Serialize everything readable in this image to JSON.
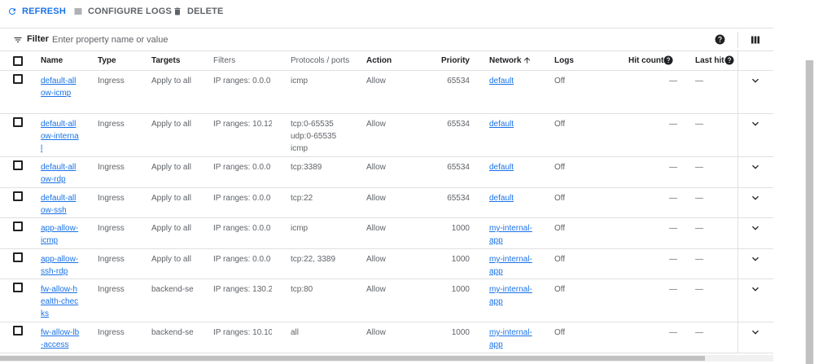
{
  "toolbar": {
    "refresh_label": "REFRESH",
    "configure_logs_label": "CONFIGURE LOGS",
    "delete_label": "DELETE"
  },
  "filter": {
    "label": "Filter",
    "placeholder": "Enter property name or value"
  },
  "table": {
    "headers": {
      "name": "Name",
      "type": "Type",
      "targets": "Targets",
      "filters": "Filters",
      "protocols": "Protocols / ports",
      "action": "Action",
      "priority": "Priority",
      "network": "Network",
      "logs": "Logs",
      "hit_count": "Hit count",
      "last_hit": "Last hit"
    },
    "rows": [
      {
        "name": "default-allow-icmp",
        "type": "Ingress",
        "targets": "Apply to all",
        "filters": "IP ranges: 0.0.0",
        "protocols": "icmp",
        "action": "Allow",
        "priority": "65534",
        "network": "default",
        "logs": "Off",
        "hit_count": "—",
        "last_hit": "—"
      },
      {
        "name": "default-allow-internal",
        "type": "Ingress",
        "targets": "Apply to all",
        "filters": "IP ranges: 10.12",
        "protocols": "tcp:0-65535\nudp:0-65535\nicmp",
        "action": "Allow",
        "priority": "65534",
        "network": "default",
        "logs": "Off",
        "hit_count": "—",
        "last_hit": "—"
      },
      {
        "name": "default-allow-rdp",
        "type": "Ingress",
        "targets": "Apply to all",
        "filters": "IP ranges: 0.0.0",
        "protocols": "tcp:3389",
        "action": "Allow",
        "priority": "65534",
        "network": "default",
        "logs": "Off",
        "hit_count": "—",
        "last_hit": "—"
      },
      {
        "name": "default-allow-ssh",
        "type": "Ingress",
        "targets": "Apply to all",
        "filters": "IP ranges: 0.0.0",
        "protocols": "tcp:22",
        "action": "Allow",
        "priority": "65534",
        "network": "default",
        "logs": "Off",
        "hit_count": "—",
        "last_hit": "—"
      },
      {
        "name": "app-allow-icmp",
        "type": "Ingress",
        "targets": "Apply to all",
        "filters": "IP ranges: 0.0.0",
        "protocols": "icmp",
        "action": "Allow",
        "priority": "1000",
        "network": "my-internal-app",
        "logs": "Off",
        "hit_count": "—",
        "last_hit": "—"
      },
      {
        "name": "app-allow-ssh-rdp",
        "type": "Ingress",
        "targets": "Apply to all",
        "filters": "IP ranges: 0.0.0",
        "protocols": "tcp:22, 3389",
        "action": "Allow",
        "priority": "1000",
        "network": "my-internal-app",
        "logs": "Off",
        "hit_count": "—",
        "last_hit": "—"
      },
      {
        "name": "fw-allow-health-checks",
        "type": "Ingress",
        "targets": "backend-se",
        "filters": "IP ranges: 130.2",
        "protocols": "tcp:80",
        "action": "Allow",
        "priority": "1000",
        "network": "my-internal-app",
        "logs": "Off",
        "hit_count": "—",
        "last_hit": "—"
      },
      {
        "name": "fw-allow-lb-access",
        "type": "Ingress",
        "targets": "backend-se",
        "filters": "IP ranges: 10.10",
        "protocols": "all",
        "action": "Allow",
        "priority": "1000",
        "network": "my-internal-app",
        "logs": "Off",
        "hit_count": "—",
        "last_hit": "—"
      }
    ]
  },
  "icons": {
    "refresh": "refresh-icon",
    "configure_logs": "list-icon",
    "delete": "trash-icon",
    "filter": "filter-icon",
    "help": "help-icon",
    "columns": "column-display-icon",
    "sort": "arrow-up-icon",
    "expand": "chevron-down-icon"
  },
  "colors": {
    "accent": "#1a73e8",
    "text": "#3c4043",
    "muted": "#5f6368",
    "divider": "#e0e0e0"
  }
}
